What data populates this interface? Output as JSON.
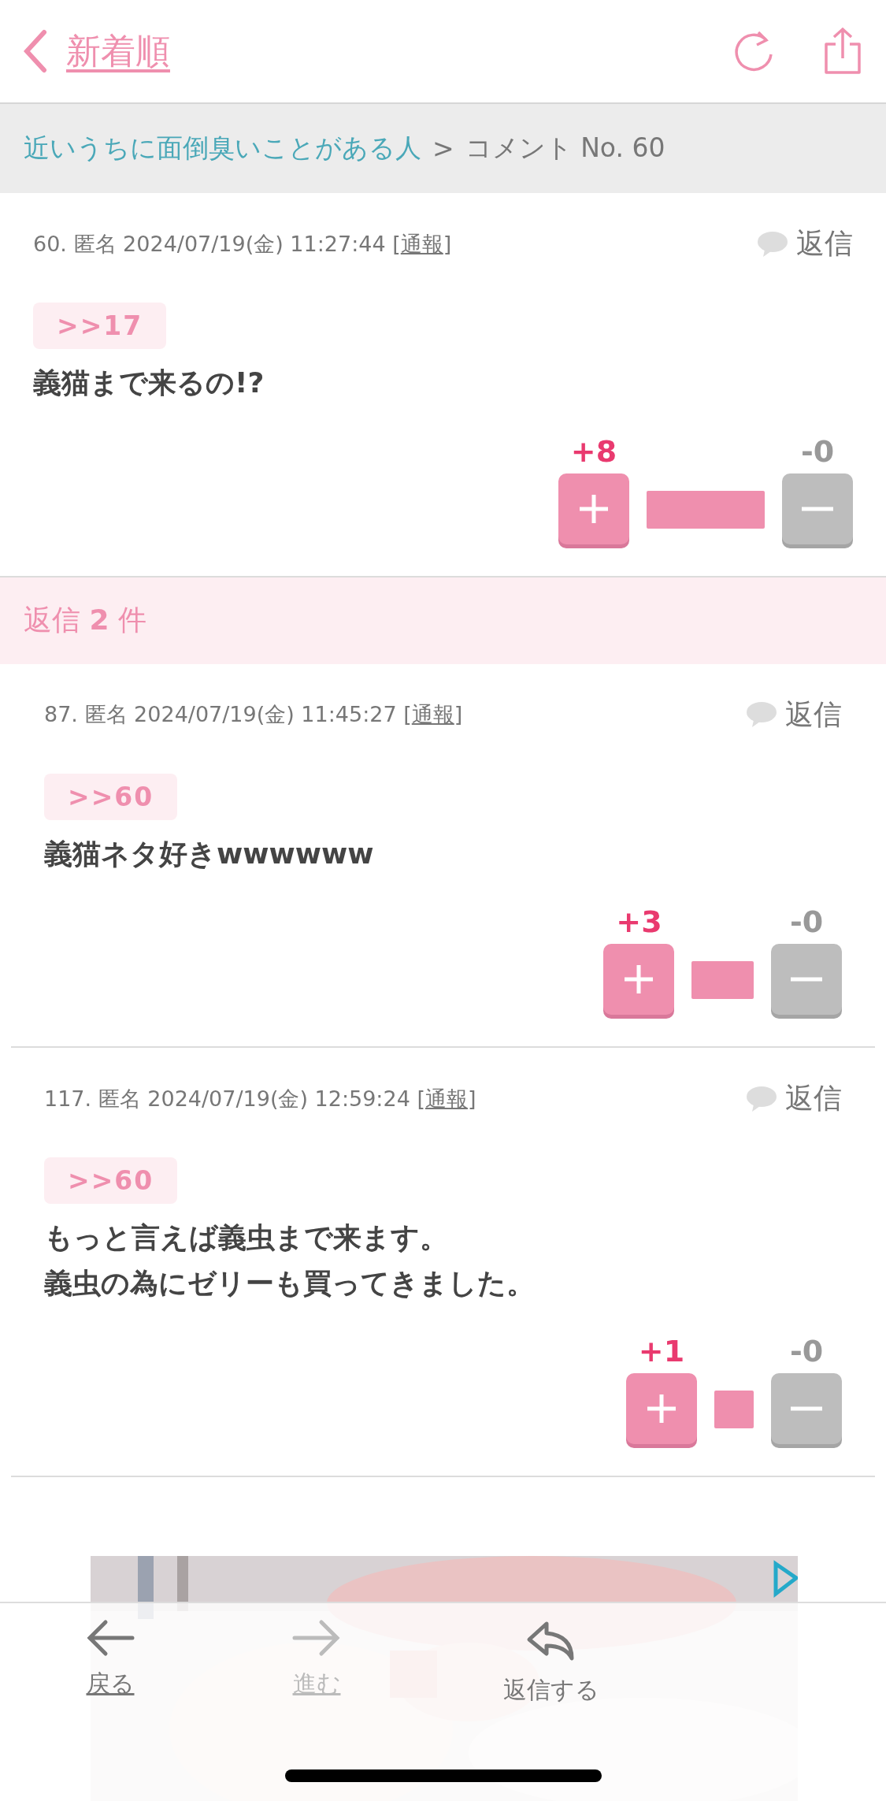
{
  "header": {
    "back_label": "新着順"
  },
  "breadcrumb": {
    "topic": "近いうちに面倒臭いことがある人",
    "separator": ">",
    "current": "コメント No. 60"
  },
  "comment": {
    "meta": "60. 匿名 2024/07/19(金) 11:27:44 [",
    "report": "通報",
    "meta_close": "]",
    "reply_label": "返信",
    "anchor": ">>17",
    "body": [
      "義猫まで来るの!?"
    ],
    "plus": "+8",
    "minus": "-0"
  },
  "replies_header": "返信 **2** 件",
  "replies": [
    {
      "meta": "87. 匿名 2024/07/19(金) 11:45:27 [",
      "report": "通報",
      "meta_close": "]",
      "reply_label": "返信",
      "anchor": ">>60",
      "body": [
        "義猫ネタ好きwwwwww"
      ],
      "plus": "+3",
      "minus": "-0"
    },
    {
      "meta": "117. 匿名 2024/07/19(金) 12:59:24 [",
      "report": "通報",
      "meta_close": "]",
      "reply_label": "返信",
      "anchor": ">>60",
      "body": [
        "もっと言えば義虫まで来ます。",
        "義虫の為にゼリーも買ってきました。"
      ],
      "plus": "+1",
      "minus": "-0"
    }
  ],
  "bottom_nav": [
    {
      "kind": "back",
      "label": "戻る",
      "disabled": false
    },
    {
      "kind": "forward",
      "label": "進む",
      "disabled": true
    },
    {
      "kind": "reply",
      "label": "返信する",
      "disabled": false
    }
  ]
}
